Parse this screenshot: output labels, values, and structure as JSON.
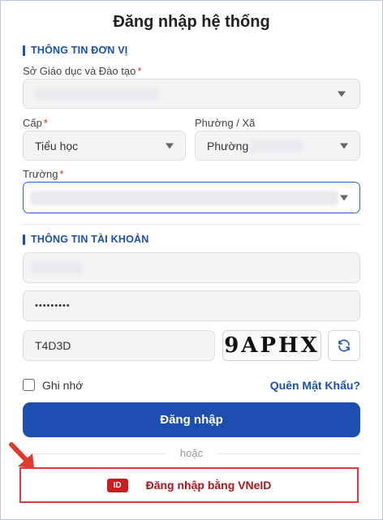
{
  "page": {
    "title": "Đăng nhập hệ thống"
  },
  "unit_section": {
    "heading": "THÔNG TIN ĐƠN VỊ",
    "department_label": "Sở Giáo dục và Đào tạo",
    "level_label": "Cấp",
    "level_value": "Tiểu học",
    "ward_label": "Phường / Xã",
    "ward_value": "Phường",
    "school_label": "Trường",
    "required_mark": "*"
  },
  "account_section": {
    "heading": "THÔNG TIN TÀI KHOẢN",
    "password_mask": "•••••••••",
    "captcha_input_value": "T4D3D",
    "captcha_image_text": "9APHX"
  },
  "options": {
    "remember_label": "Ghi nhớ",
    "forgot_link": "Quên Mật Khẩu?"
  },
  "actions": {
    "login_button": "Đăng nhập",
    "or_separator": "hoặc",
    "vneid_badge": "ID",
    "vneid_button": "Đăng nhập bằng VNeID"
  },
  "colors": {
    "primary": "#1d4fb1",
    "accent_blue": "#1a4fb7",
    "required_red": "#e02424",
    "vneid_red": "#c81e1e",
    "highlight_border": "#e03a3a"
  },
  "icons": {
    "dropdown": "chevron-down-icon",
    "refresh": "refresh-icon",
    "arrow": "red-arrow-icon"
  }
}
